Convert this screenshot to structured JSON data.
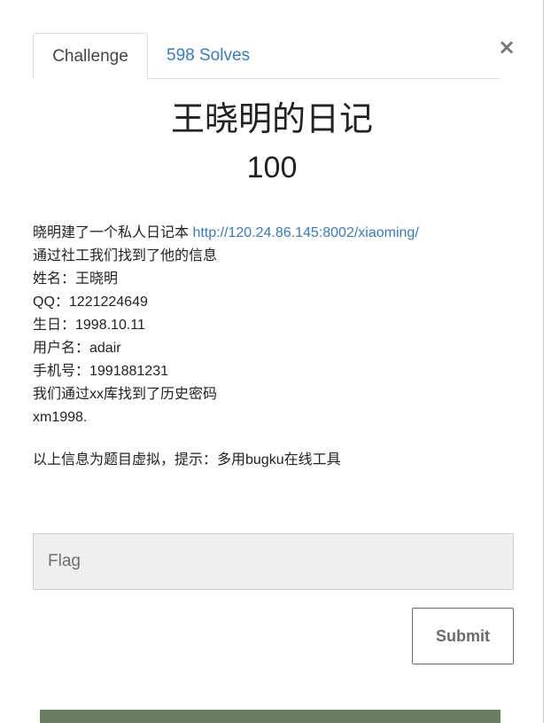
{
  "tabs": {
    "challenge": "Challenge",
    "solves": "598 Solves"
  },
  "close_label": "×",
  "challenge": {
    "name": "王晓明的日记",
    "points": "100",
    "description": {
      "intro": "晓明建了一个私人日记本 ",
      "link": "http://120.24.86.145:8002/xiaoming/",
      "lines": [
        "通过社工我们找到了他的信息",
        "姓名：王晓明",
        "QQ：1221224649",
        "生日：1998.10.11",
        "用户名：adair",
        "手机号：1991881231",
        "我们通过xx库找到了历史密码",
        "xm1998."
      ]
    },
    "hint": "以上信息为题目虚拟，提示：多用bugku在线工具"
  },
  "form": {
    "flag_placeholder": "Flag",
    "flag_value": "",
    "submit_label": "Submit"
  },
  "colors": {
    "link": "#3b7ab8",
    "input_bg": "#efefef"
  }
}
